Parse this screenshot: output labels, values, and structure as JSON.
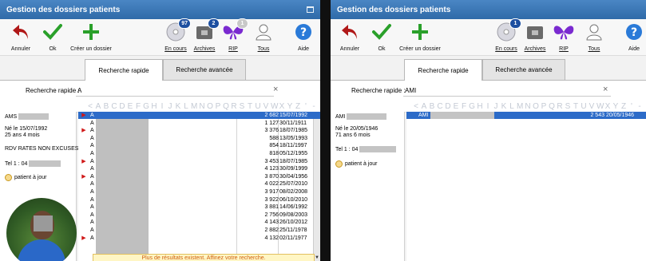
{
  "left": {
    "title": "Gestion des dossiers patients",
    "toolbar": {
      "annuler": "Annuler",
      "ok": "Ok",
      "creer": "Créer un dossier",
      "en_cours": "En cours",
      "en_cours_badge": "97",
      "archives": "Archives",
      "archives_badge": "2",
      "rip": "RIP",
      "rip_badge": "1",
      "tous": "Tous",
      "aide": "Aide"
    },
    "tabs": {
      "rapide": "Recherche rapide",
      "avancee": "Recherche avancée"
    },
    "search": {
      "label": "Recherche rapide :",
      "value": "A",
      "clear": "×"
    },
    "alphabet": [
      "<",
      "A",
      "B",
      "C",
      "D",
      "E",
      "F",
      "G",
      "H",
      "I",
      "J",
      "K",
      "L",
      "M",
      "N",
      "O",
      "P",
      "Q",
      "R",
      "S",
      "T",
      "U",
      "V",
      "W",
      "X",
      "Y",
      "Z",
      "'",
      "-"
    ],
    "detail": {
      "name": "AMS",
      "born": "Né le 15/07/1992",
      "age": "25 ans 4 mois",
      "note": "RDV RATES NON EXCUSES",
      "tel": "Tel 1 : 04",
      "status": "patient à jour"
    },
    "rows": [
      {
        "flag": "▶",
        "pre": "A",
        "num": "2 682",
        "date": "15/07/1992"
      },
      {
        "flag": "",
        "pre": "A",
        "num": "1 127",
        "date": "30/11/1911"
      },
      {
        "flag": "▶",
        "pre": "A",
        "num": "3 376",
        "date": "18/07/1985"
      },
      {
        "flag": "",
        "pre": "A",
        "num": "588",
        "date": "13/05/1993"
      },
      {
        "flag": "",
        "pre": "A",
        "num": "854",
        "date": "18/11/1997"
      },
      {
        "flag": "",
        "pre": "A",
        "num": "818",
        "date": "05/12/1955"
      },
      {
        "flag": "▶",
        "pre": "A",
        "num": "3 453",
        "date": "18/07/1985"
      },
      {
        "flag": "",
        "pre": "A",
        "num": "4 123",
        "date": "30/09/1999"
      },
      {
        "flag": "▶",
        "pre": "A",
        "num": "3 870",
        "date": "30/04/1956"
      },
      {
        "flag": "",
        "pre": "A",
        "num": "4 022",
        "date": "25/07/2010"
      },
      {
        "flag": "",
        "pre": "A",
        "num": "3 917",
        "date": "08/02/2008"
      },
      {
        "flag": "",
        "pre": "A",
        "num": "3 922",
        "date": "06/10/2010"
      },
      {
        "flag": "",
        "pre": "A",
        "num": "3 881",
        "date": "14/06/1992"
      },
      {
        "flag": "",
        "pre": "A",
        "num": "2 756",
        "date": "09/08/2003"
      },
      {
        "flag": "",
        "pre": "A",
        "num": "4 143",
        "date": "26/10/2012"
      },
      {
        "flag": "",
        "pre": "A",
        "num": "2 882",
        "date": "25/11/1978"
      },
      {
        "flag": "▶",
        "pre": "A",
        "num": "4 132",
        "date": "02/11/1977"
      }
    ],
    "more": "Plus de résultats existent. Affinez votre recherche."
  },
  "right": {
    "title": "Gestion des dossiers patients",
    "toolbar": {
      "annuler": "Annuler",
      "ok": "Ok",
      "creer": "Créer un dossier",
      "en_cours": "En cours",
      "en_cours_badge": "1",
      "archives": "Archives",
      "rip": "RIP",
      "tous": "Tous",
      "aide": "Aide"
    },
    "tabs": {
      "rapide": "Recherche rapide",
      "avancee": "Recherche avancée"
    },
    "search": {
      "label": "Recherche rapide :",
      "value": "AMI",
      "clear": "×"
    },
    "alphabet": [
      "<",
      "A",
      "B",
      "C",
      "D",
      "E",
      "F",
      "G",
      "H",
      "I",
      "J",
      "K",
      "L",
      "M",
      "N",
      "O",
      "P",
      "Q",
      "R",
      "S",
      "T",
      "U",
      "V",
      "W",
      "X",
      "Y",
      "Z",
      "'",
      "-"
    ],
    "detail": {
      "name": "AMI",
      "born": "Né le 20/05/1946",
      "age": "71 ans 6 mois",
      "tel": "Tel 1 : 04",
      "status": "patient à jour"
    },
    "rows": [
      {
        "pre": "AMI",
        "num": "2 543",
        "date": "20/05/1946"
      }
    ]
  },
  "colors": {
    "titlebar": "#3a78b8",
    "selection": "#2c6bc8",
    "flag": "#d01818",
    "accent_green": "#2aa02a",
    "help_blue": "#2a7ad8"
  }
}
